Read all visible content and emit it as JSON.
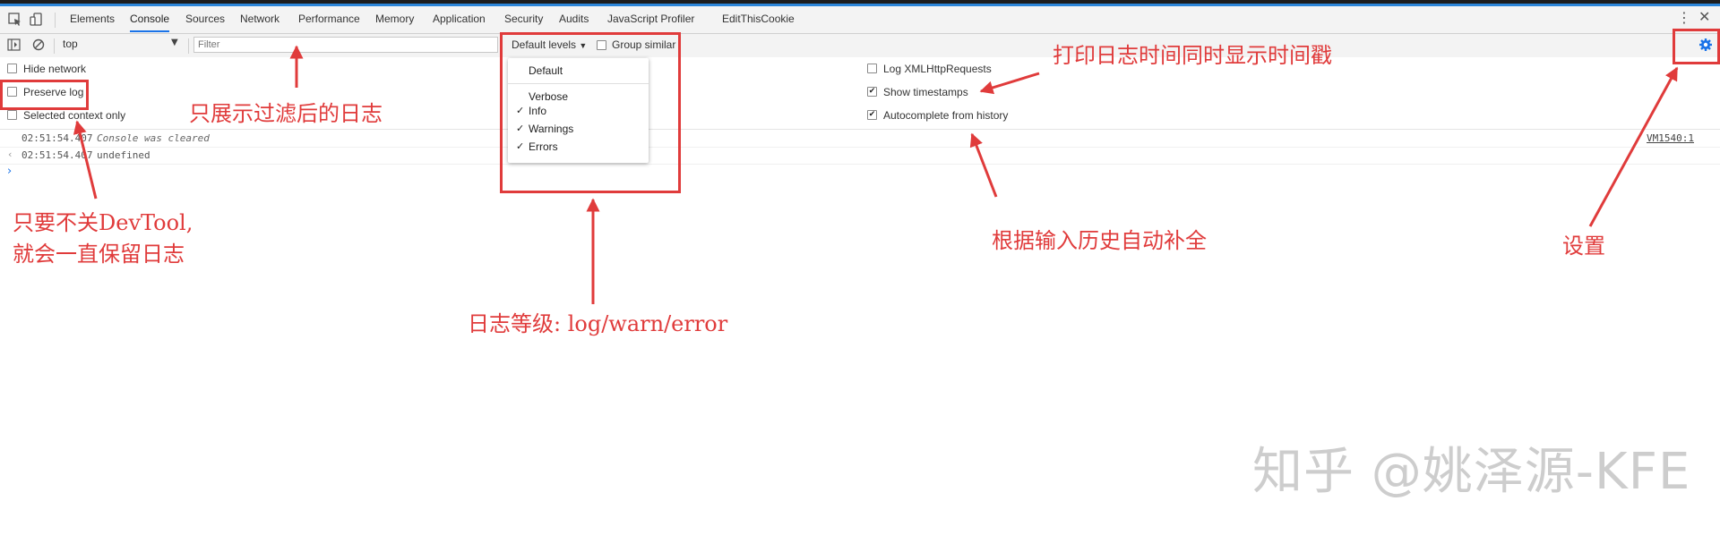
{
  "tabs": [
    "Elements",
    "Console",
    "Sources",
    "Network",
    "Performance",
    "Memory",
    "Application",
    "Security",
    "Audits",
    "JavaScript Profiler",
    "EditThisCookie"
  ],
  "toolbar": {
    "context": "top",
    "filter_placeholder": "Filter",
    "levels_label": "Default levels",
    "group_similar": "Group similar"
  },
  "settings": {
    "hide_network": "Hide network",
    "preserve_log": "Preserve log",
    "selected_context": "Selected context only",
    "log_xhr": "Log XMLHttpRequests",
    "show_timestamps": "Show timestamps",
    "autocomplete": "Autocomplete from history",
    "show_timestamps_checked": true,
    "autocomplete_checked": true
  },
  "levels_menu": {
    "default": "Default",
    "verbose": "Verbose",
    "info": "Info",
    "warnings": "Warnings",
    "errors": "Errors"
  },
  "messages": [
    {
      "time": "02:51:54.407",
      "text": "Console was cleared",
      "source": "VM1540:1"
    },
    {
      "time": "02:51:54.407",
      "text": "undefined"
    }
  ],
  "annotations": {
    "filter": "只展示过滤后的日志",
    "preserve_line1": "只要不关DevTool,",
    "preserve_line2": "就会一直保留日志",
    "levels": "日志等级: log/warn/error",
    "timestamps": "打印日志时间同时显示时间戳",
    "autocomplete": "根据输入历史自动补全",
    "settings": "设置"
  },
  "watermark": "知乎 @姚泽源-KFE",
  "colors": {
    "annotation": "#e03b3b",
    "accent": "#1a73e8",
    "toolbar_bg": "#f3f3f3"
  }
}
